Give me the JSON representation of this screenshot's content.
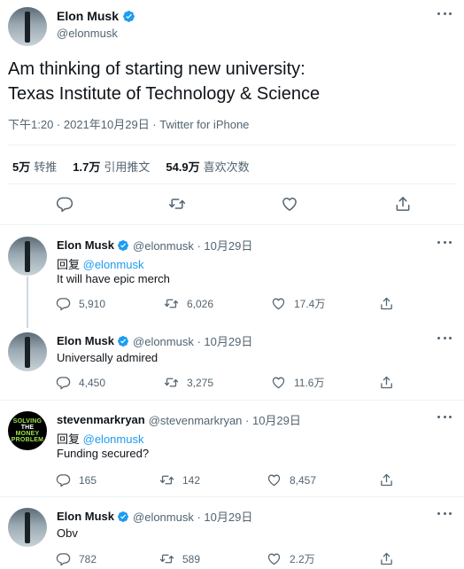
{
  "main_tweet": {
    "name": "Elon Musk",
    "handle": "@elonmusk",
    "text_line1": "Am thinking of starting new university:",
    "text_line2": "Texas Institute of Technology & Science",
    "meta_time": "下午1:20 · 2021年10月29日 · ",
    "meta_source": "Twitter for iPhone",
    "stats": [
      {
        "value": "5万",
        "label": "转推"
      },
      {
        "value": "1.7万",
        "label": "引用推文"
      },
      {
        "value": "54.9万",
        "label": "喜欢次数"
      }
    ],
    "actions": [
      "reply-icon",
      "retweet-icon",
      "like-icon",
      "share-icon"
    ]
  },
  "replies": [
    {
      "name": "Elon Musk",
      "handle": "@elonmusk · 10月29日",
      "verified": true,
      "reply_to_label": "回复 ",
      "reply_to_handle": "@elonmusk",
      "text": "It will have epic merch",
      "counts": {
        "reply": "5,910",
        "retweet": "6,026",
        "like": "17.4万"
      }
    },
    {
      "name": "Elon Musk",
      "handle": "@elonmusk · 10月29日",
      "verified": true,
      "text": "Universally admired",
      "counts": {
        "reply": "4,450",
        "retweet": "3,275",
        "like": "11.6万"
      }
    },
    {
      "name": "stevenmarkryan",
      "handle": "@stevenmarkryan · 10月29日",
      "verified": false,
      "reply_to_label": "回复 ",
      "reply_to_handle": "@elonmusk",
      "text": "Funding secured?",
      "avatar_logo": [
        "SOLVING",
        "THE",
        "MONEY",
        "PROBLEM"
      ],
      "counts": {
        "reply": "165",
        "retweet": "142",
        "like": "8,457"
      }
    },
    {
      "name": "Elon Musk",
      "handle": "@elonmusk · 10月29日",
      "verified": true,
      "text": "Obv",
      "counts": {
        "reply": "782",
        "retweet": "589",
        "like": "2.2万"
      }
    }
  ],
  "colors": {
    "accent": "#1d9bf0",
    "text": "#0f1419",
    "muted": "#536471",
    "divider": "#eff3f4"
  }
}
